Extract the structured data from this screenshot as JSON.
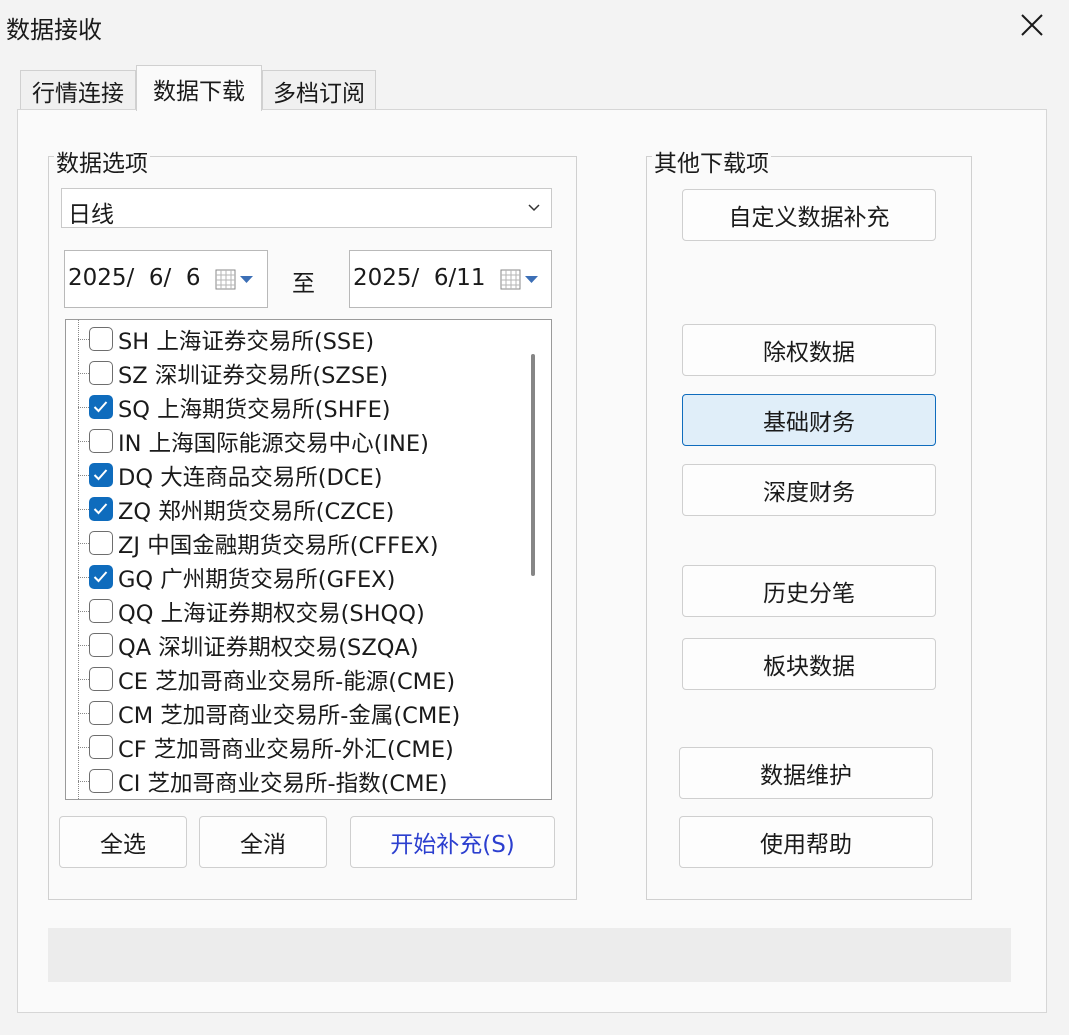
{
  "window": {
    "title": "数据接收"
  },
  "tabs": [
    {
      "label": "行情连接"
    },
    {
      "label": "数据下载"
    },
    {
      "label": "多档订阅"
    }
  ],
  "data_options": {
    "group_title": "数据选项",
    "period": "日线",
    "start_date": "2025/  6/  6",
    "to_label": "至",
    "end_date": "2025/  6/11",
    "exchanges": [
      {
        "label": "SH 上海证券交易所(SSE)",
        "checked": false
      },
      {
        "label": "SZ 深圳证券交易所(SZSE)",
        "checked": false
      },
      {
        "label": "SQ 上海期货交易所(SHFE)",
        "checked": true
      },
      {
        "label": "IN 上海国际能源交易中心(INE)",
        "checked": false
      },
      {
        "label": "DQ 大连商品交易所(DCE)",
        "checked": true
      },
      {
        "label": "ZQ 郑州期货交易所(CZCE)",
        "checked": true
      },
      {
        "label": "ZJ 中国金融期货交易所(CFFEX)",
        "checked": false
      },
      {
        "label": "GQ 广州期货交易所(GFEX)",
        "checked": true
      },
      {
        "label": "QQ 上海证券期权交易(SHQQ)",
        "checked": false
      },
      {
        "label": "QA 深圳证券期权交易(SZQA)",
        "checked": false
      },
      {
        "label": "CE 芝加哥商业交易所-能源(CME)",
        "checked": false
      },
      {
        "label": "CM 芝加哥商业交易所-金属(CME)",
        "checked": false
      },
      {
        "label": "CF 芝加哥商业交易所-外汇(CME)",
        "checked": false
      },
      {
        "label": "CI 芝加哥商业交易所-指数(CME)",
        "checked": false
      }
    ],
    "select_all": "全选",
    "deselect_all": "全消",
    "start_fill": "开始补充(S)"
  },
  "other_downloads": {
    "group_title": "其他下载项",
    "custom_fill": "自定义数据补充",
    "ex_rights": "除权数据",
    "basic_finance": "基础财务",
    "deep_finance": "深度财务",
    "history_ticks": "历史分笔",
    "sector_data": "板块数据",
    "data_maintenance": "数据维护",
    "help": "使用帮助"
  },
  "colors": {
    "accent": "#0f6cbd",
    "link": "#2c3fcf",
    "highlight_bg": "#e0eef9"
  }
}
